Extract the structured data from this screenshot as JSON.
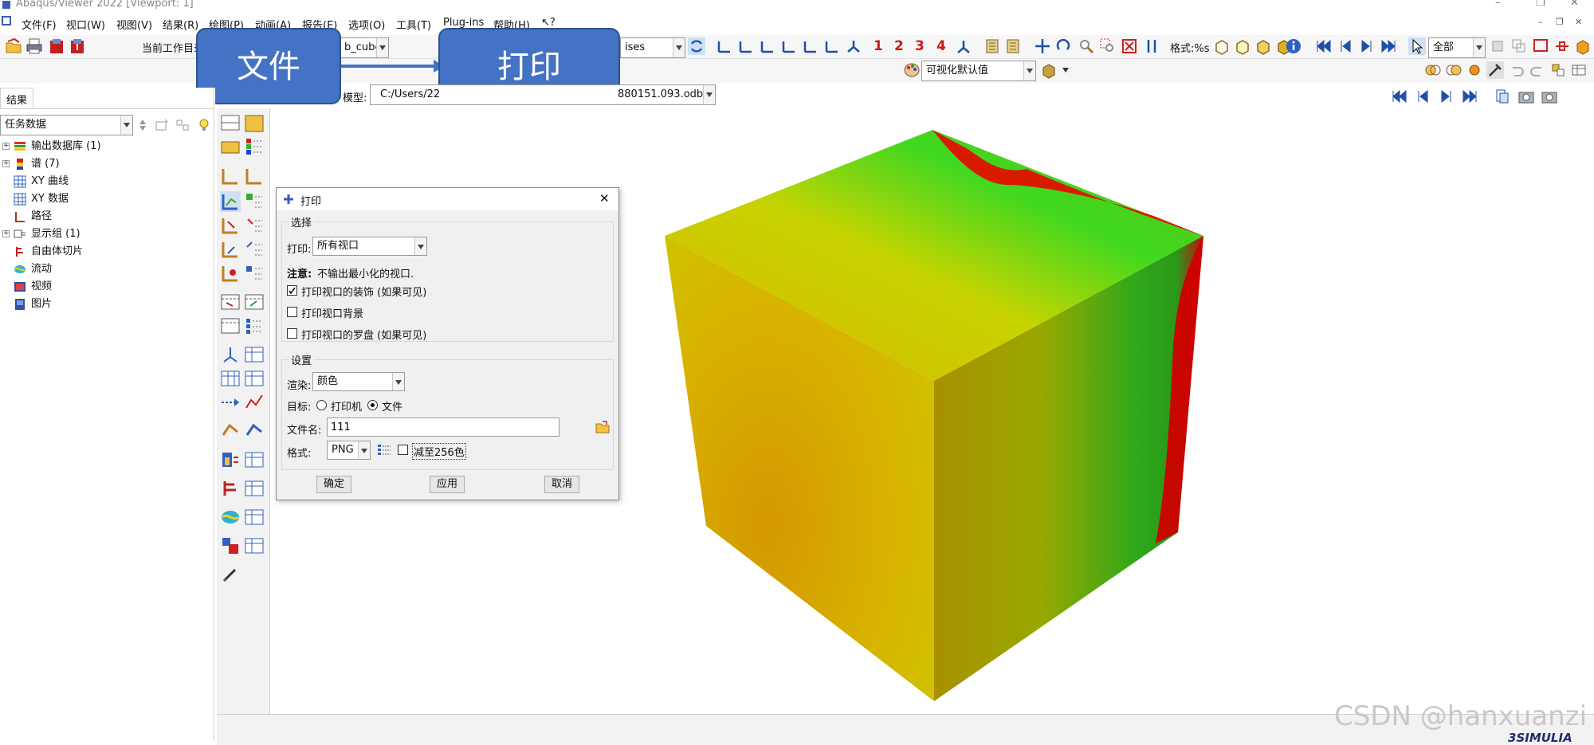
{
  "window": {
    "title": "Abaqus/Viewer 2022 [Viewport: 1]",
    "controls": [
      "–",
      "❐",
      "✕"
    ],
    "mdi_controls": [
      "–",
      "❐",
      "✕"
    ]
  },
  "menubar": {
    "items": [
      "文件(F)",
      "视口(W)",
      "视图(V)",
      "结果(R)",
      "绘图(P)",
      "动画(A)",
      "报告(E)",
      "选项(O)",
      "工具(T)",
      "Plug-ins",
      "帮助(H)",
      "↖?"
    ]
  },
  "toolbar": {
    "work_dir_label": "当前工作目录",
    "step_combo_value": "b_cube",
    "mises_combo_value": "ises",
    "numbers": [
      "1",
      "2",
      "3",
      "4"
    ],
    "format_label": "格式:%s",
    "select_filter_value": "全部",
    "visual_defaults_value": "可视化默认值"
  },
  "context_bar": {
    "model_label": "模型:",
    "model_path_start": "C:/Users/22",
    "model_path_end": "880151.093.odb"
  },
  "callouts": {
    "file": "文件",
    "print": "打印"
  },
  "results_tab": "结果",
  "task_data_value": "任务数据",
  "tree": [
    {
      "label": "输出数据库 (1)",
      "expand": "+",
      "icon": "database-icon"
    },
    {
      "label": "谱 (7)",
      "expand": "+",
      "icon": "spectrum-icon"
    },
    {
      "label": "XY 曲线",
      "expand": "",
      "icon": "xy-curve-icon"
    },
    {
      "label": "XY 数据",
      "expand": "",
      "icon": "xy-data-icon"
    },
    {
      "label": "路径",
      "expand": "",
      "icon": "path-icon"
    },
    {
      "label": "显示组 (1)",
      "expand": "+",
      "icon": "display-group-icon"
    },
    {
      "label": "自由体切片",
      "expand": "",
      "icon": "free-body-cut-icon"
    },
    {
      "label": "流动",
      "expand": "",
      "icon": "stream-icon"
    },
    {
      "label": "视频",
      "expand": "",
      "icon": "movie-icon"
    },
    {
      "label": "图片",
      "expand": "",
      "icon": "image-icon"
    }
  ],
  "dialog": {
    "title": "打印",
    "close": "✕",
    "selection_group": "选择",
    "print_label": "打印:",
    "print_value": "所有视口",
    "note_label": "注意:",
    "note_text": "不输出最小化的视口.",
    "options": [
      {
        "label": "打印视口的装饰 (如果可见)",
        "checked": true
      },
      {
        "label": "打印视口背景",
        "checked": false
      },
      {
        "label": "打印视口的罗盘 (如果可见)",
        "checked": false
      }
    ],
    "settings_group": "设置",
    "render_label": "渲染:",
    "render_value": "颜色",
    "destination_label": "目标:",
    "dest_printer": "打印机",
    "dest_file": "文件",
    "dest_selected": "file",
    "filename_label": "文件名:",
    "filename_value": "111",
    "format_label": "格式:",
    "format_value": "PNG",
    "reduce_label": "减至256色",
    "reduce_checked": false,
    "ok": "确定",
    "apply": "应用",
    "cancel": "取消"
  },
  "watermark": "CSDN @hanxuanzi",
  "brand": "SIMULIA",
  "colors": {
    "callout": "#4472c4",
    "cube_yellow": "#d8b400",
    "cube_green": "#3fd820",
    "cube_red": "#e00000"
  }
}
